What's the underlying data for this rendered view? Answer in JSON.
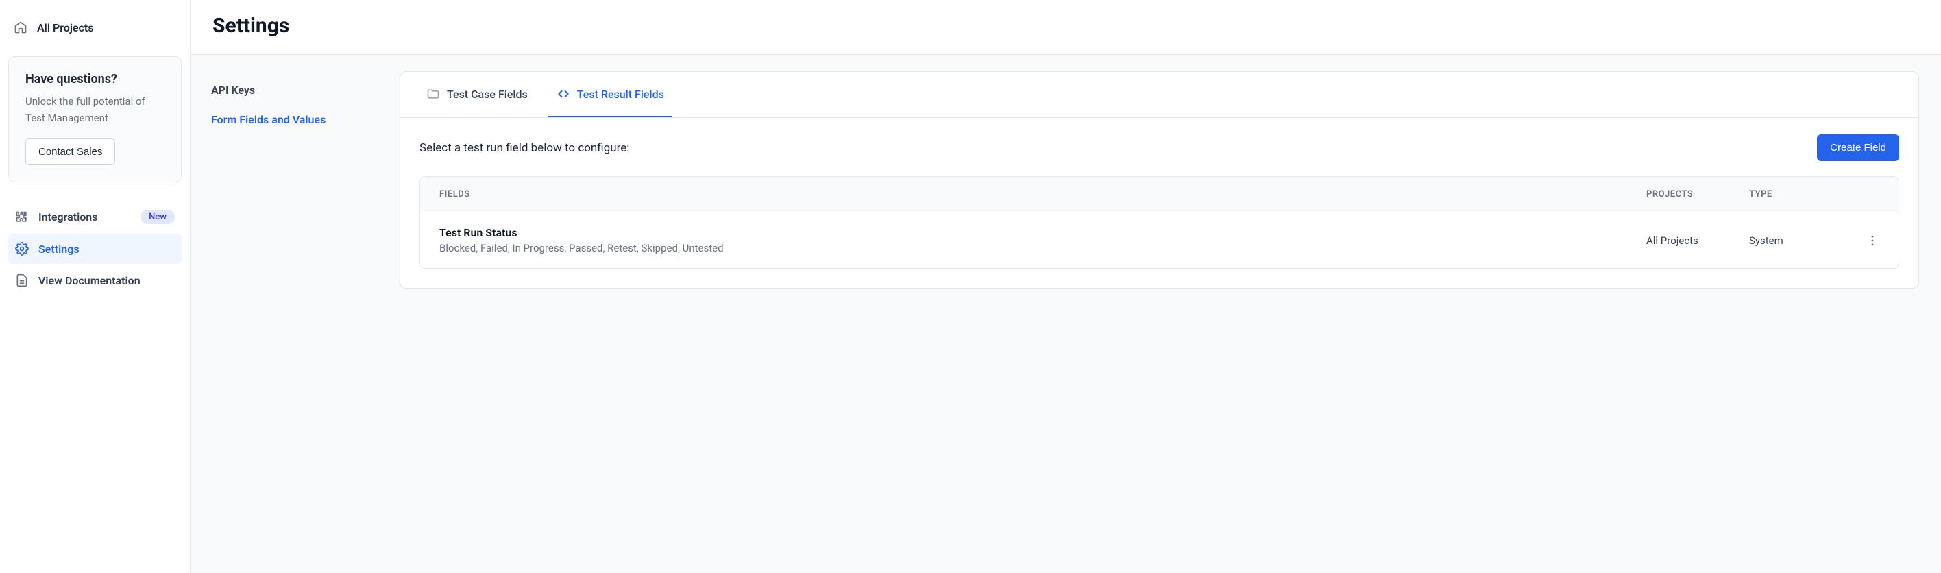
{
  "sidebar": {
    "all_projects": "All Projects",
    "promo": {
      "title": "Have questions?",
      "text": "Unlock the full potential of Test Management",
      "cta": "Contact Sales"
    },
    "nav": {
      "integrations": {
        "label": "Integrations",
        "badge": "New"
      },
      "settings": {
        "label": "Settings"
      },
      "docs": {
        "label": "View Documentation"
      }
    }
  },
  "page": {
    "title": "Settings",
    "subnav": {
      "api_keys": "API Keys",
      "form_fields": "Form Fields and Values"
    },
    "tabs": {
      "test_case": "Test Case Fields",
      "test_result": "Test Result Fields"
    },
    "instruction": "Select a test run field below to configure:",
    "create_button": "Create Field",
    "table": {
      "headers": {
        "fields": "FIELDS",
        "projects": "PROJECTS",
        "type": "TYPE"
      },
      "row1": {
        "title": "Test Run Status",
        "subtitle": "Blocked, Failed, In Progress, Passed, Retest, Skipped, Untested",
        "projects": "All Projects",
        "type": "System"
      }
    }
  }
}
